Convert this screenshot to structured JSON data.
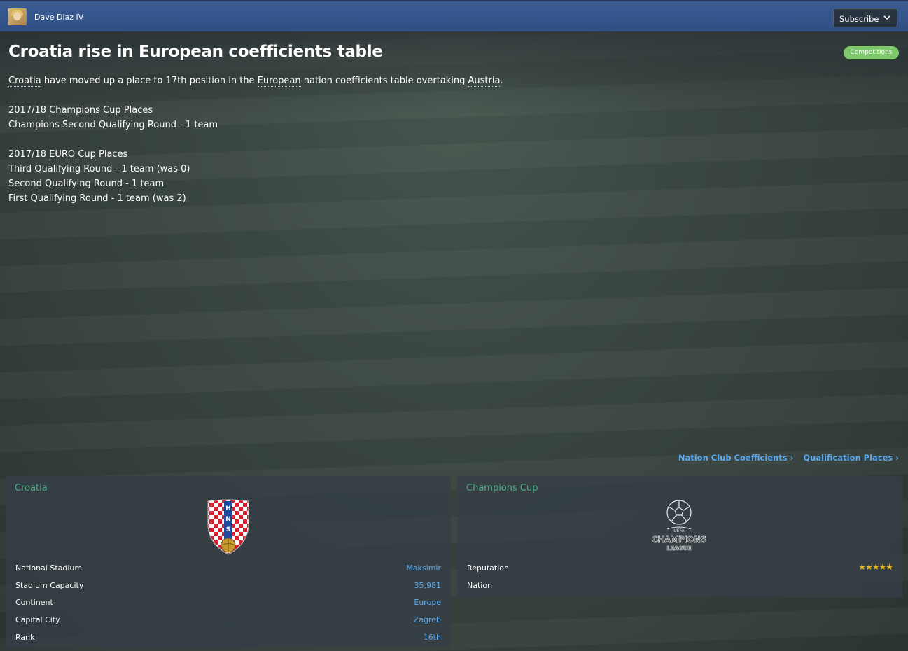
{
  "header": {
    "author": "Dave Diaz IV",
    "subscribe_label": "Subscribe"
  },
  "article": {
    "title": "Croatia rise in European coefficients table",
    "tag": "Competitions",
    "intro": {
      "nation": "Croatia",
      "part1": " have moved up a place to 17th position in the ",
      "continent": "European",
      "part2": " nation coefficients table overtaking ",
      "rival": "Austria",
      "part3": "."
    },
    "champions_section": {
      "year": "2017/18 ",
      "competition": "Champions Cup",
      "suffix": " Places",
      "lines": [
        "Champions Second Qualifying Round - 1 team"
      ]
    },
    "euro_section": {
      "year": "2017/18 ",
      "competition": "EURO Cup",
      "suffix": " Places",
      "lines": [
        "Third Qualifying Round - 1 team (was 0)",
        "Second Qualifying Round - 1 team",
        "First Qualifying Round - 1 team (was 2)"
      ]
    }
  },
  "links": {
    "nation_club_coefficients": "Nation Club Coefficients",
    "qualification_places": "Qualification Places"
  },
  "nation_panel": {
    "title": "Croatia",
    "crest_text": [
      "H",
      "N",
      "S"
    ],
    "rows": [
      {
        "label": "National Stadium",
        "value": "Maksimir"
      },
      {
        "label": "Stadium Capacity",
        "value": "35,981"
      },
      {
        "label": "Continent",
        "value": "Europe"
      },
      {
        "label": "Capital City",
        "value": "Zagreb"
      },
      {
        "label": "Rank",
        "value": "16th"
      }
    ]
  },
  "competition_panel": {
    "title": "Champions Cup",
    "rows": [
      {
        "label": "Reputation",
        "value": ""
      },
      {
        "label": "Nation",
        "value": ""
      }
    ],
    "reputation_stars": 5
  },
  "colors": {
    "header_blue": "#2f4f84",
    "accent_green": "#4fae88",
    "link_blue": "#5aa9f0",
    "tag_green": "#7cc86a",
    "star_gold": "#f2b915"
  }
}
